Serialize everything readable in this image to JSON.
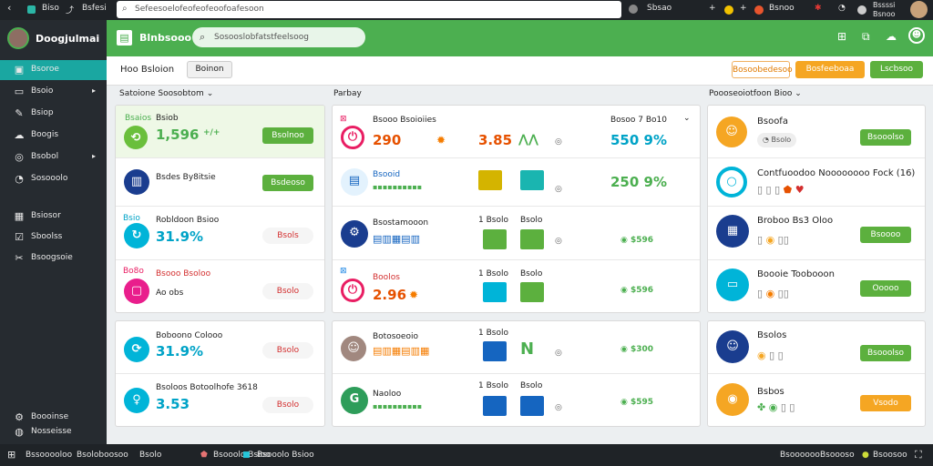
{
  "browser": {
    "tab_title": "Biso",
    "tab2": "Bsfesi",
    "address": "Sefeesoelofeofeofeoofoafesoon",
    "profile": "Sbsao",
    "user_label": "Bsnoo",
    "account_line1": "Bssssi",
    "account_line2": "Bsnoo"
  },
  "sidebar": {
    "user_name": "Doogjulmai",
    "items": [
      {
        "icon": "dashboard-icon",
        "label": "Bsoroe",
        "arrow": ""
      },
      {
        "icon": "window-icon",
        "label": "Bsoio",
        "arrow": "▸"
      },
      {
        "icon": "edit-icon",
        "label": "Bsiop",
        "arrow": ""
      },
      {
        "icon": "cloud-icon",
        "label": "Boogis",
        "arrow": ""
      },
      {
        "icon": "target-icon",
        "label": "Bsobol",
        "arrow": "▸"
      },
      {
        "icon": "chat-icon",
        "label": "Sosooolo",
        "arrow": ""
      },
      {
        "icon": "calendar-icon",
        "label": "Bsiosor",
        "arrow": ""
      },
      {
        "icon": "check-icon",
        "label": "Sboolss",
        "arrow": ""
      },
      {
        "icon": "tools-icon",
        "label": "Bsoogsoie",
        "arrow": ""
      }
    ],
    "footer": [
      {
        "icon": "settings-icon",
        "label": "Boooinse"
      },
      {
        "icon": "user-icon",
        "label": "Nosseisse"
      }
    ]
  },
  "header": {
    "app_name": "Blnbsooo",
    "search_placeholder": "Sosooslobfatstfeelsoog"
  },
  "toolbar": {
    "title": "Hoo Bsloion",
    "chip": "Boinon",
    "btn_outline": "Bosoobedesoo",
    "btn_orange": "Bosfeeboaa",
    "btn_green": "Lscbsoo"
  },
  "sections": {
    "left": "Satoione Soosobtom",
    "middle": "Parbay",
    "right": "Poooseoiotfoon Bioo"
  },
  "left_panel": {
    "rows": [
      {
        "tag": "Bsaios",
        "name": "Bsiob",
        "value": "1,596",
        "extra": "+/+",
        "action": "Bsolnoo",
        "action_type": "green"
      },
      {
        "tag": "",
        "name": "Bsdes By8itsie",
        "value": "",
        "extra": "",
        "action": "Bsdeoso",
        "action_type": "green"
      },
      {
        "tag": "Bsio",
        "name": "Robldoon Bsioo",
        "value": "31.9%",
        "extra": "",
        "action": "Bsols",
        "action_type": "pill"
      },
      {
        "tag": "Bo8o",
        "name": "Bsooo Bsoloo",
        "value": "",
        "extra": "Ao obs",
        "action": "Bsolo",
        "action_type": "pill"
      },
      {
        "tag": "",
        "name": "Boboono Colooo",
        "value": "31.9%",
        "extra": "",
        "action": "Bsolo",
        "action_type": "pill"
      },
      {
        "tag": "",
        "name": "Bsoloos Botoolhofe 3618",
        "value": "3.53",
        "extra": "",
        "action": "Bsolo",
        "action_type": "pill"
      }
    ]
  },
  "middle_panel": {
    "rows": [
      {
        "title": "Bsooo Bsoioiies",
        "value": "290",
        "value2": "3.85",
        "label3": "Bosoo 7 Bo10",
        "value3": "550 9%"
      },
      {
        "title": "Bsooid",
        "value": "",
        "value2": "",
        "label3": "",
        "value3": "250 9%"
      },
      {
        "title": "Bsostamooon",
        "value": "",
        "value2": "1 Bsolo",
        "label3": "Bsolo",
        "value3": "$596"
      },
      {
        "title": "Boolos",
        "value": "2.96",
        "value2": "1 Bsolo",
        "label3": "Bsolo",
        "value3": "$596"
      },
      {
        "title": "Botosoeoio",
        "value": "",
        "value2": "1 Bsolo",
        "label3": "",
        "value3": "$300"
      },
      {
        "title": "Naoloo",
        "value": "",
        "value2": "1 Bsolo",
        "label3": "Bsolo",
        "value3": "$595"
      }
    ]
  },
  "right_panel": {
    "rows": [
      {
        "name": "Bsoofa",
        "chip": "Bsolo",
        "action": "Bsooolso",
        "action_type": "green"
      },
      {
        "name": "Contfuoodoo Noooooooo Fock (16)",
        "chip": "",
        "action": "",
        "action_type": ""
      },
      {
        "name": "Broboo Bs3 Oloo",
        "chip": "",
        "action": "Bsoooo",
        "action_type": "green"
      },
      {
        "name": "Boooie Toobooon",
        "chip": "",
        "action": "Ooooo",
        "action_type": "green"
      },
      {
        "name": "Bsolos",
        "chip": "",
        "action": "Bsooolso",
        "action_type": "green"
      },
      {
        "name": "Bsbos",
        "chip": "",
        "action": "Vsodo",
        "action_type": "orange"
      }
    ]
  },
  "bottombar": {
    "items": [
      "Bssooooloo",
      "Bsoloboosoo",
      "Bsolo",
      "Bsooolo Bsioo"
    ],
    "right": [
      "Bsoooooo",
      "Bsoooso",
      "Bsoosoo"
    ]
  }
}
